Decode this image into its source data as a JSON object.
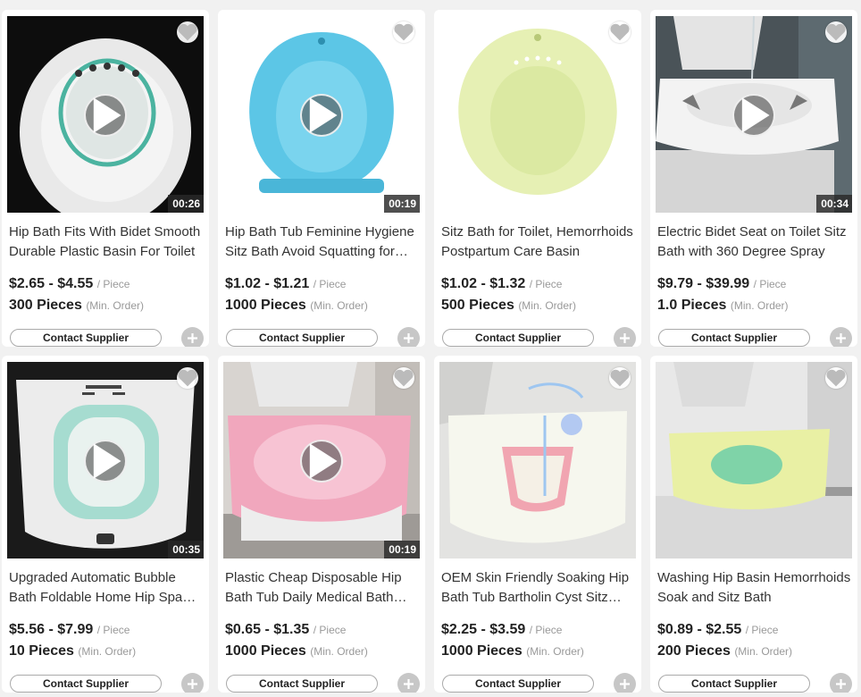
{
  "ui": {
    "play_icon": "play-icon",
    "heart_icon": "heart-icon",
    "plus_icon": "plus-icon",
    "price_unit": "/ Piece",
    "moq_note": "(Min. Order)",
    "contact_label": "Contact Supplier"
  },
  "products": [
    {
      "title": "Hip Bath Fits With Bidet Smooth Durable Plastic Basin For Toilet",
      "price": "$2.65 - $4.55",
      "moq": "300 Pieces",
      "duration": "00:26"
    },
    {
      "title": "Hip Bath Tub Feminine Hygiene Sitz Bath Avoid Squatting for Women",
      "price": "$1.02 - $1.21",
      "moq": "1000 Pieces",
      "duration": "00:19"
    },
    {
      "title": "Sitz Bath for Toilet, Hemorrhoids Postpartum Care Basin",
      "price": "$1.02 - $1.32",
      "moq": "500 Pieces",
      "duration": ""
    },
    {
      "title": "Electric Bidet Seat on Toilet Sitz Bath with 360 Degree Spray",
      "price": "$9.79 - $39.99",
      "moq": "1.0 Pieces",
      "duration": "00:34"
    },
    {
      "title": "Upgraded Automatic Bubble Bath Foldable Home Hip Spa Basin",
      "price": "$5.56 - $7.99",
      "moq": "10 Pieces",
      "duration": "00:35"
    },
    {
      "title": "Plastic Cheap Disposable Hip Bath Tub Daily Medical Bath Basin",
      "price": "$0.65 - $1.35",
      "moq": "1000 Pieces",
      "duration": "00:19"
    },
    {
      "title": "OEM Skin Friendly Soaking Hip Bath Tub Bartholin Cyst Sitz Bath",
      "price": "$2.25 - $3.59",
      "moq": "1000 Pieces",
      "duration": ""
    },
    {
      "title": "Washing Hip Basin Hemorrhoids Soak and Sitz Bath",
      "price": "$0.89 - $2.55",
      "moq": "200 Pieces",
      "duration": ""
    }
  ]
}
